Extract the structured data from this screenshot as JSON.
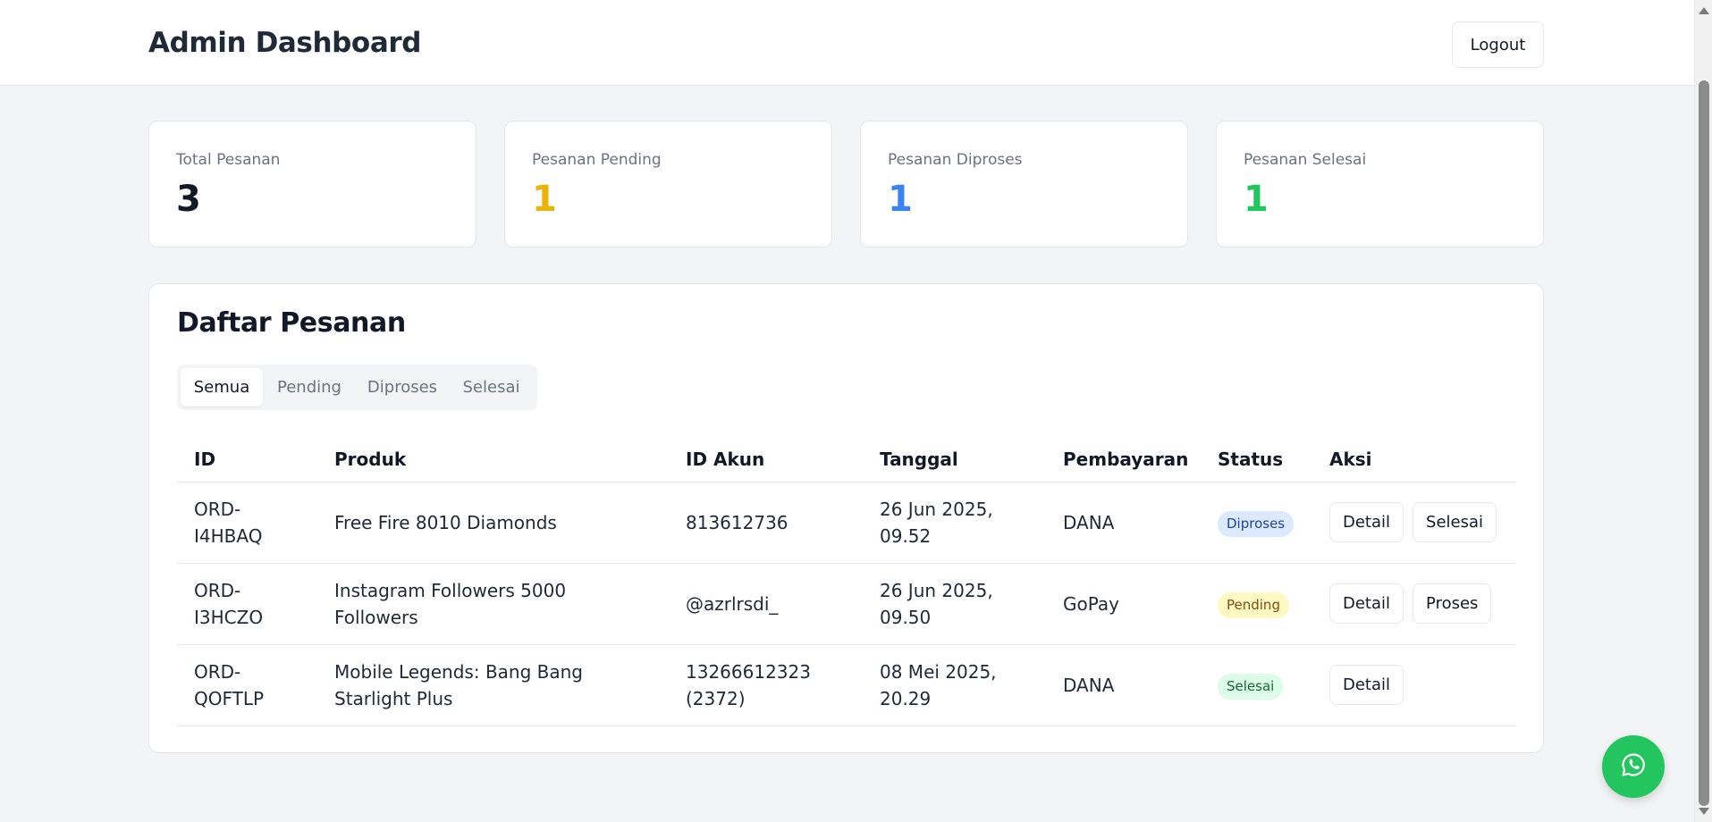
{
  "header": {
    "title": "Admin Dashboard",
    "logout_label": "Logout"
  },
  "stats": [
    {
      "label": "Total Pesanan",
      "value": "3",
      "color": "#111827"
    },
    {
      "label": "Pesanan Pending",
      "value": "1",
      "color": "#eab308"
    },
    {
      "label": "Pesanan Diproses",
      "value": "1",
      "color": "#3b82f6"
    },
    {
      "label": "Pesanan Selesai",
      "value": "1",
      "color": "#22c55e"
    }
  ],
  "orders": {
    "title": "Daftar Pesanan",
    "tabs": [
      {
        "label": "Semua",
        "active": true
      },
      {
        "label": "Pending",
        "active": false
      },
      {
        "label": "Diproses",
        "active": false
      },
      {
        "label": "Selesai",
        "active": false
      }
    ],
    "columns": [
      "ID",
      "Produk",
      "ID Akun",
      "Tanggal",
      "Pembayaran",
      "Status",
      "Aksi"
    ],
    "rows": [
      {
        "id": [
          "ORD-",
          "I4HBAQ"
        ],
        "product": [
          "Free Fire 8010 Diamonds"
        ],
        "account": [
          "813612736"
        ],
        "date": [
          "26 Jun 2025,",
          "09.52"
        ],
        "payment": "DANA",
        "status": "Diproses",
        "status_colors": {
          "bg": "#dbeafe",
          "fg": "#1e40af"
        },
        "actions": [
          "Detail",
          "Selesai"
        ]
      },
      {
        "id": [
          "ORD-",
          "I3HCZO"
        ],
        "product": [
          "Instagram Followers 5000",
          "Followers"
        ],
        "account": [
          "@azrlrsdi_"
        ],
        "date": [
          "26 Jun 2025,",
          "09.50"
        ],
        "payment": "GoPay",
        "status": "Pending",
        "status_colors": {
          "bg": "#fef9c3",
          "fg": "#854d0e"
        },
        "actions": [
          "Detail",
          "Proses"
        ]
      },
      {
        "id": [
          "ORD-",
          "QOFTLP"
        ],
        "product": [
          "Mobile Legends: Bang Bang",
          "Starlight Plus"
        ],
        "account": [
          "13266612323",
          "(2372)"
        ],
        "date": [
          "08 Mei 2025,",
          "20.29"
        ],
        "payment": "DANA",
        "status": "Selesai",
        "status_colors": {
          "bg": "#dcfce7",
          "fg": "#166534"
        },
        "actions": [
          "Detail"
        ]
      }
    ]
  },
  "fab": {
    "icon": "whatsapp-icon",
    "color": "#22c55e"
  }
}
